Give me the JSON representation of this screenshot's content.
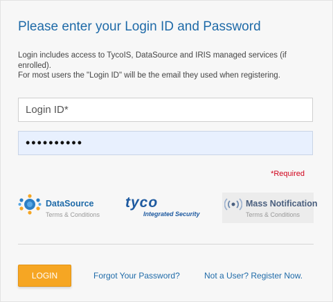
{
  "form": {
    "heading": "Please enter your Login ID and Password",
    "info_line1": "Login includes access to TycoIS, DataSource and IRIS managed services (if",
    "info_line2": "enrolled).",
    "info_line3": "For most users the \"Login ID\" will be the email they used when registering.",
    "login_id_placeholder": "Login ID*",
    "login_id_value": "",
    "password_value": "••••••••••",
    "required_note": "*Required"
  },
  "partners": {
    "datasource_name": "DataSource",
    "datasource_terms": "Terms & Conditions",
    "tyco_name": "tyco",
    "tyco_sub": "Integrated Security",
    "mass_notification_name": "Mass Notification",
    "mass_notification_terms": "Terms & Conditions"
  },
  "actions": {
    "login_label": "LOGIN",
    "forgot_label": "Forgot Your Password?",
    "register_label": "Not a User? Register Now."
  },
  "colors": {
    "accent": "#1e6aa8",
    "login_button": "#f6a623",
    "required": "#d0021b",
    "password_fill": "#e8f0fe"
  }
}
